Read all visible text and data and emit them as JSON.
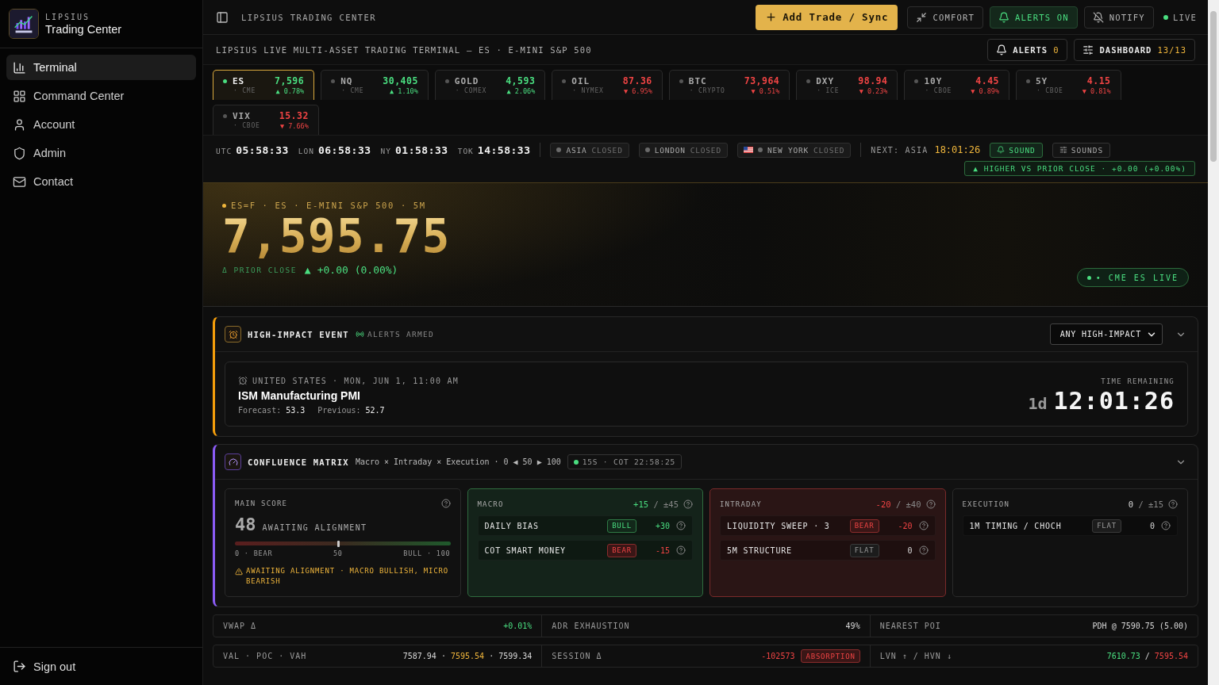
{
  "sidebar": {
    "brand_top": "LIPSIUS",
    "brand": "Trading Center",
    "items": [
      {
        "label": "Terminal",
        "selected": true
      },
      {
        "label": "Command Center",
        "selected": false
      },
      {
        "label": "Account",
        "selected": false
      },
      {
        "label": "Admin",
        "selected": false
      },
      {
        "label": "Contact",
        "selected": false
      }
    ],
    "sign_out": "Sign out"
  },
  "topbar": {
    "title": "LIPSIUS TRADING CENTER",
    "primary": "Add Trade / Sync",
    "toggles": [
      {
        "label": "COMFORT",
        "on": false
      },
      {
        "label": "ALERTS ON",
        "on": true
      },
      {
        "label": "NOTIFY",
        "on": false
      }
    ],
    "status": "LIVE"
  },
  "header": {
    "title": "LIPSIUS LIVE MULTI-ASSET TRADING TERMINAL — ES · E-MINI S&P 500",
    "alerts_label": "ALERTS",
    "alerts_count": "0",
    "dashboard_label": "DASHBOARD",
    "dashboard_count": "13/13"
  },
  "tickers": [
    {
      "symbol": "ES",
      "exchange": "· CME",
      "price": "7,596",
      "change": "▲ 0.78%",
      "rising": true,
      "selected": true
    },
    {
      "symbol": "NQ",
      "exchange": "· CME",
      "price": "30,405",
      "change": "▲ 1.10%",
      "rising": true,
      "selected": false
    },
    {
      "symbol": "GOLD",
      "exchange": "· COMEX",
      "price": "4,593",
      "change": "▲ 2.06%",
      "rising": true,
      "selected": false
    },
    {
      "symbol": "OIL",
      "exchange": "· NYMEX",
      "price": "87.36",
      "change": "▼ 6.95%",
      "rising": false,
      "selected": false
    },
    {
      "symbol": "BTC",
      "exchange": "· CRYPTO",
      "price": "73,964",
      "change": "▼ 0.51%",
      "rising": false,
      "selected": false
    },
    {
      "symbol": "DXY",
      "exchange": "· ICE",
      "price": "98.94",
      "change": "▼ 0.23%",
      "rising": false,
      "selected": false
    },
    {
      "symbol": "10Y",
      "exchange": "· CBOE",
      "price": "4.45",
      "change": "▼ 0.89%",
      "rising": false,
      "selected": false
    },
    {
      "symbol": "5Y",
      "exchange": "· CBOE",
      "price": "4.15",
      "change": "▼ 0.81%",
      "rising": false,
      "selected": false
    },
    {
      "symbol": "VIX",
      "exchange": "· CBOE",
      "price": "15.32",
      "change": "▼ 7.66%",
      "rising": false,
      "selected": false
    }
  ],
  "sessions": {
    "clocks": [
      {
        "zone": "UTC",
        "time": "05:58:33"
      },
      {
        "zone": "LON",
        "time": "06:58:33"
      },
      {
        "zone": "NY",
        "time": "01:58:33"
      },
      {
        "zone": "TOK",
        "time": "14:58:33"
      }
    ],
    "markets": [
      {
        "name": "ASIA",
        "status": "CLOSED",
        "flag": false
      },
      {
        "name": "LONDON",
        "status": "CLOSED",
        "flag": false
      },
      {
        "name": "NEW YORK",
        "status": "CLOSED",
        "flag": true
      }
    ],
    "next_label": "NEXT: ASIA",
    "next_time": "18:01:26",
    "sound": {
      "label": "SOUND",
      "on": true
    },
    "sounds": "SOUNDS",
    "trend": "▲ HIGHER VS PRIOR CLOSE · +0.00 (+0.00%)"
  },
  "hero": {
    "symbol_line": "ES=F · ES · E-MINI S&P 500 · 5M",
    "price": "7,595.75",
    "delta_label": "Δ PRIOR CLOSE",
    "delta_arrow": "▲",
    "delta_value": "+0.00 (0.00%)",
    "live": "• CME ES LIVE"
  },
  "event": {
    "title": "HIGH-IMPACT EVENT",
    "armed": "ALERTS ARMED",
    "filter": "ANY HIGH-IMPACT",
    "meta": "UNITED STATES · MON, JUN 1, 11:00 AM",
    "name": "ISM Manufacturing PMI",
    "forecast_label": "Forecast:",
    "forecast": "53.3",
    "previous_label": "Previous:",
    "previous": "52.7",
    "remaining_label": "TIME REMAINING",
    "days": "1d",
    "time": "12:01:26"
  },
  "confluence": {
    "title": "CONFLUENCE MATRIX",
    "subtitle": "Macro × Intraday × Execution · 0 ◀ 50 ▶ 100",
    "chip": "15S · COT 22:58:25",
    "main": {
      "label": "MAIN SCORE",
      "score": "48",
      "status": "AWAITING ALIGNMENT",
      "level": 0.48,
      "scale": [
        "0 · BEAR",
        "50",
        "BULL · 100"
      ],
      "warning": "AWAITING ALIGNMENT · MACRO BULLISH, MICRO BEARISH"
    },
    "panels": [
      {
        "name": "MACRO",
        "score": "+15",
        "range": "/ ±45",
        "kind": "bull",
        "rows": [
          {
            "label": "DAILY BIAS",
            "tag": "BULL",
            "kind": "bull",
            "value": "+30"
          },
          {
            "label": "COT SMART MONEY",
            "tag": "BEAR",
            "kind": "bear",
            "value": "-15"
          }
        ]
      },
      {
        "name": "INTRADAY",
        "score": "-20",
        "range": "/ ±40",
        "kind": "bear",
        "rows": [
          {
            "label": "LIQUIDITY SWEEP · 3",
            "tag": "BEAR",
            "kind": "bear",
            "value": "-20"
          },
          {
            "label": "5M STRUCTURE",
            "tag": "FLAT",
            "kind": "flat",
            "value": "0"
          }
        ]
      },
      {
        "name": "EXECUTION",
        "score": "0",
        "range": "/ ±15",
        "kind": "flat",
        "rows": [
          {
            "label": "1M TIMING / CHOCH",
            "tag": "FLAT",
            "kind": "flat",
            "value": "0"
          }
        ]
      }
    ]
  },
  "metrics": [
    [
      {
        "label": "VWAP Δ",
        "parts": [
          {
            "text": "+0.01%",
            "kind": "bull"
          }
        ]
      },
      {
        "label": "ADR EXHAUSTION",
        "parts": [
          {
            "text": "49%",
            "kind": "flat"
          }
        ]
      },
      {
        "label": "NEAREST POI",
        "parts": [
          {
            "text": "PDH @ 7590.75 (5.00)",
            "kind": "flat"
          }
        ]
      }
    ],
    [
      {
        "label": "VAL · POC · VAH",
        "parts": [
          {
            "text": "7587.94 · ",
            "kind": "flat"
          },
          {
            "text": "7595.54",
            "kind": "gold"
          },
          {
            "text": " · 7599.34",
            "kind": "flat"
          }
        ]
      },
      {
        "label": "SESSION Δ",
        "parts": [
          {
            "text": "-102573",
            "kind": "bear"
          }
        ],
        "tag": "ABSORPTION"
      },
      {
        "label": "LVN ↑ / HVN ↓",
        "parts": [
          {
            "text": "7610.73",
            "kind": "bull"
          },
          {
            "text": " / ",
            "kind": "flat"
          },
          {
            "text": "7595.54",
            "kind": "bear"
          }
        ]
      }
    ]
  ]
}
